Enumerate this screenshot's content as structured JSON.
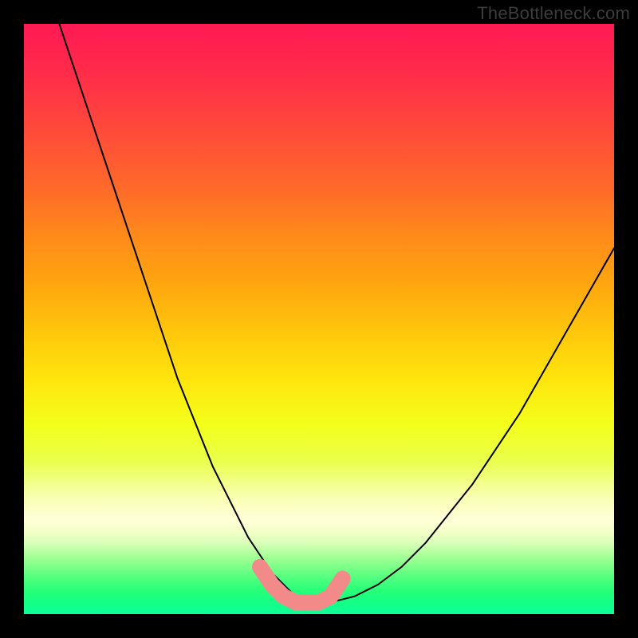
{
  "watermark": "TheBottleneck.com",
  "chart_data": {
    "type": "line",
    "title": "",
    "xlabel": "",
    "ylabel": "",
    "xlim": [
      0,
      100
    ],
    "ylim": [
      0,
      100
    ],
    "grid": false,
    "legend": false,
    "gradient_background": {
      "top_color": "#ff1a53",
      "mid_color": "#ffe40c",
      "bottom_color": "#14ff86"
    },
    "series": [
      {
        "name": "bottleneck-curve",
        "color": "#000000",
        "x": [
          6,
          8,
          10,
          12,
          14,
          16,
          18,
          20,
          22,
          24,
          26,
          28,
          30,
          32,
          34,
          36,
          38,
          40,
          42,
          44,
          46,
          48,
          50,
          52,
          56,
          60,
          64,
          68,
          72,
          76,
          80,
          84,
          88,
          92,
          96,
          100
        ],
        "y": [
          100,
          94,
          88,
          82,
          76,
          70,
          64,
          58,
          52,
          46,
          40,
          35,
          30,
          25,
          21,
          17,
          13,
          10,
          7,
          5,
          3,
          2,
          2,
          2,
          3,
          5,
          8,
          12,
          17,
          22,
          28,
          34,
          41,
          48,
          55,
          62
        ]
      },
      {
        "name": "optimal-band-marker",
        "color": "#f28a8a",
        "marker": "round-cap-thick",
        "x": [
          40,
          42,
          44,
          46,
          48,
          50,
          52,
          54
        ],
        "y": [
          8,
          5,
          3,
          2,
          2,
          2,
          3,
          6
        ]
      }
    ],
    "annotations": []
  }
}
